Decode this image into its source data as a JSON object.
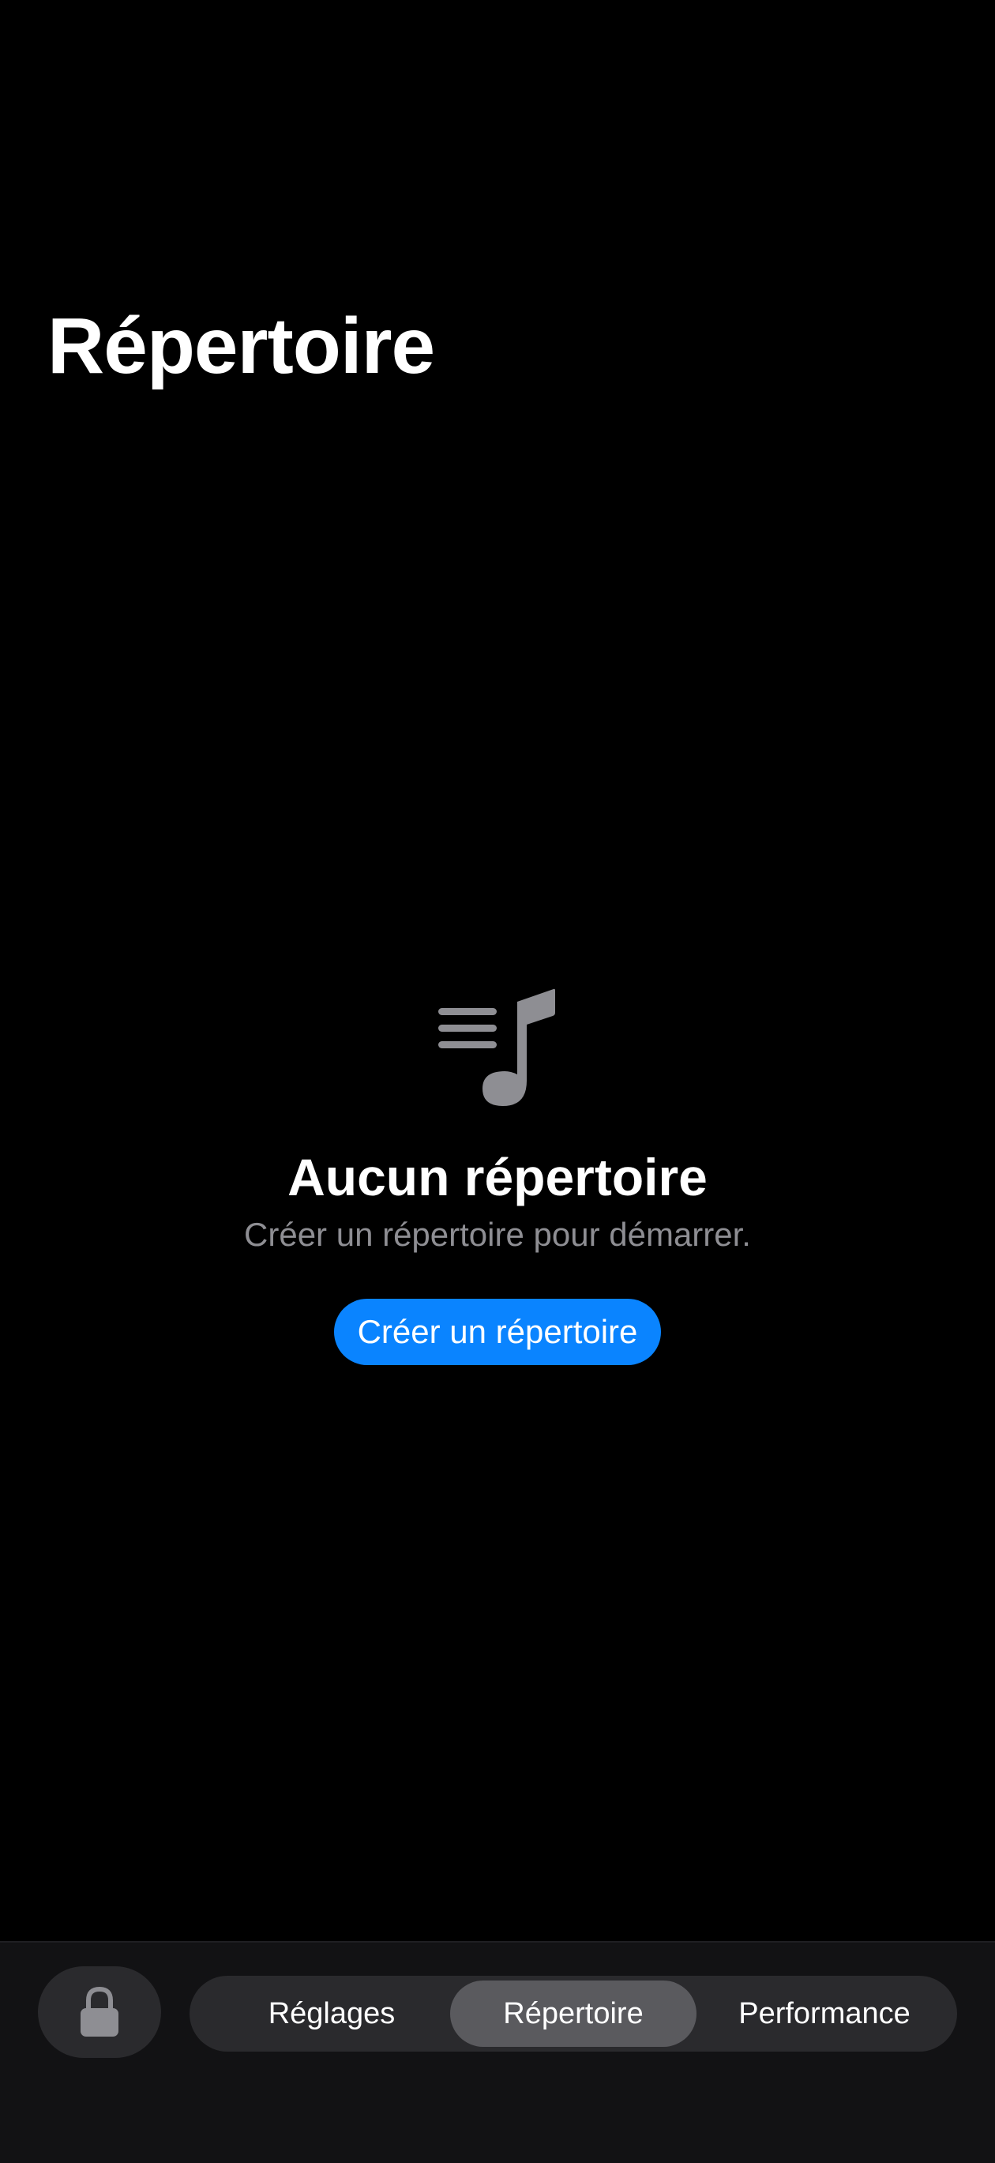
{
  "header": {
    "title": "Répertoire"
  },
  "empty_state": {
    "icon": "music-list-icon",
    "title": "Aucun répertoire",
    "subtitle": "Créer un répertoire pour démarrer.",
    "button_label": "Créer un répertoire"
  },
  "tab_bar": {
    "lock_icon": "lock-icon",
    "tabs": [
      {
        "label": "Réglages",
        "selected": false
      },
      {
        "label": "Répertoire",
        "selected": true
      },
      {
        "label": "Performance",
        "selected": false
      }
    ]
  },
  "colors": {
    "background": "#000000",
    "accent": "#0a84ff",
    "secondary_text": "#8e8e93",
    "tab_bar_background": "#121214",
    "segment_background": "#2a2a2d",
    "segment_selected": "#5a5a5e"
  }
}
